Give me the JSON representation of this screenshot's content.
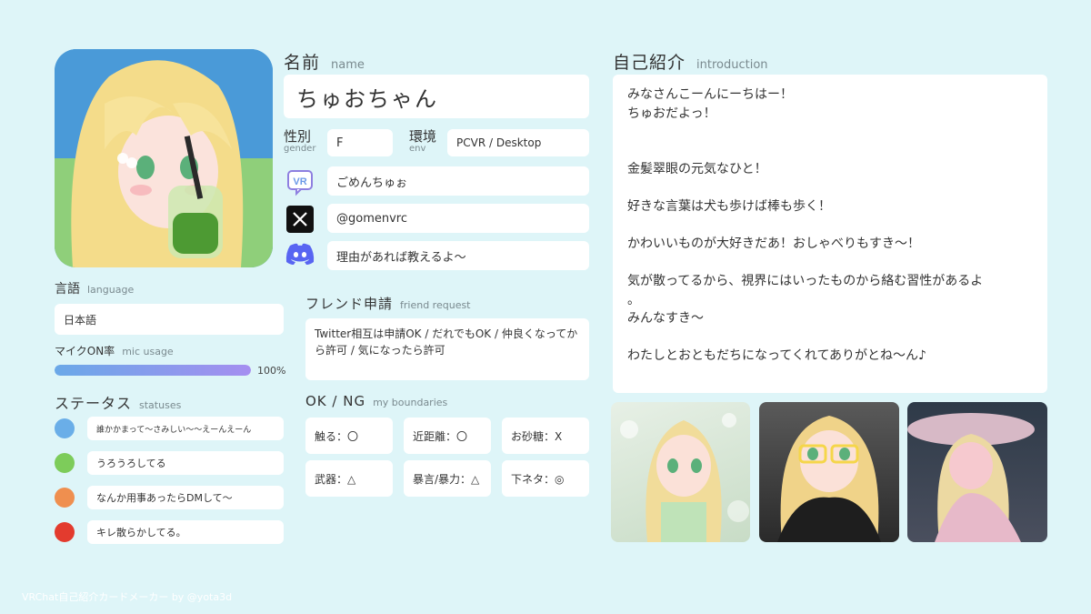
{
  "name": {
    "label_jp": "名前",
    "label_en": "name",
    "value": "ちゅおちゃん"
  },
  "gender": {
    "label_jp": "性別",
    "label_en": "gender",
    "value": "F"
  },
  "env": {
    "label_jp": "環境",
    "label_en": "env",
    "value": "PCVR / Desktop"
  },
  "accounts": {
    "vrchat": "ごめんちゅぉ",
    "x": "@gomenvrc",
    "discord": "理由があれば教えるよ〜"
  },
  "language": {
    "label_jp": "言語",
    "label_en": "language",
    "value": "日本語"
  },
  "mic": {
    "label_jp": "マイクON率",
    "label_en": "mic usage",
    "percent_text": "100%",
    "fraction": 1.0
  },
  "statuses": {
    "label_jp": "ステータス",
    "label_en": "statuses",
    "items": [
      {
        "color": "#6aaee8",
        "text": "誰かかまって〜さみしい〜〜えーんえーん"
      },
      {
        "color": "#7dcc5a",
        "text": "うろうろしてる"
      },
      {
        "color": "#ef8f4f",
        "text": "なんか用事あったらDMして〜"
      },
      {
        "color": "#e33b2e",
        "text": "キレ散らかしてる。"
      }
    ]
  },
  "friend_request": {
    "label_jp": "フレンド申請",
    "label_en": "friend request",
    "text": "Twitter相互は申請OK / だれでもOK / 仲良くなってから許可 / 気になったら許可"
  },
  "boundaries": {
    "label_jp": "OK / NG",
    "label_en": "my boundaries",
    "items": [
      "触る：〇",
      "近距離：〇",
      "お砂糖：X",
      "武器：△",
      "暴言/暴力：△",
      "下ネタ：◎"
    ]
  },
  "introduction": {
    "label_jp": "自己紹介",
    "label_en": "introduction",
    "lines": [
      "みなさんこーんにーちはー！",
      "ちゅおだよっ！",
      "",
      "",
      "金髪翠眼の元気なひと！",
      "",
      "好きな言葉は犬も歩けば棒も歩く！",
      "",
      "かわいいものが大好きだあ！おしゃべりもすき〜！",
      "",
      "気が散ってるから、視界にはいったものから絡む習性があるよ",
      "。",
      "みんなすき〜",
      "",
      "わたしとおともだちになってくれてありがとね〜ん♪"
    ]
  },
  "footer": "VRChat自己紹介カードメーカー by @yota3d",
  "colors": {
    "background": "#def5f8",
    "mic_bar_start": "#6aa8e8",
    "mic_bar_end": "#a58ef0"
  }
}
